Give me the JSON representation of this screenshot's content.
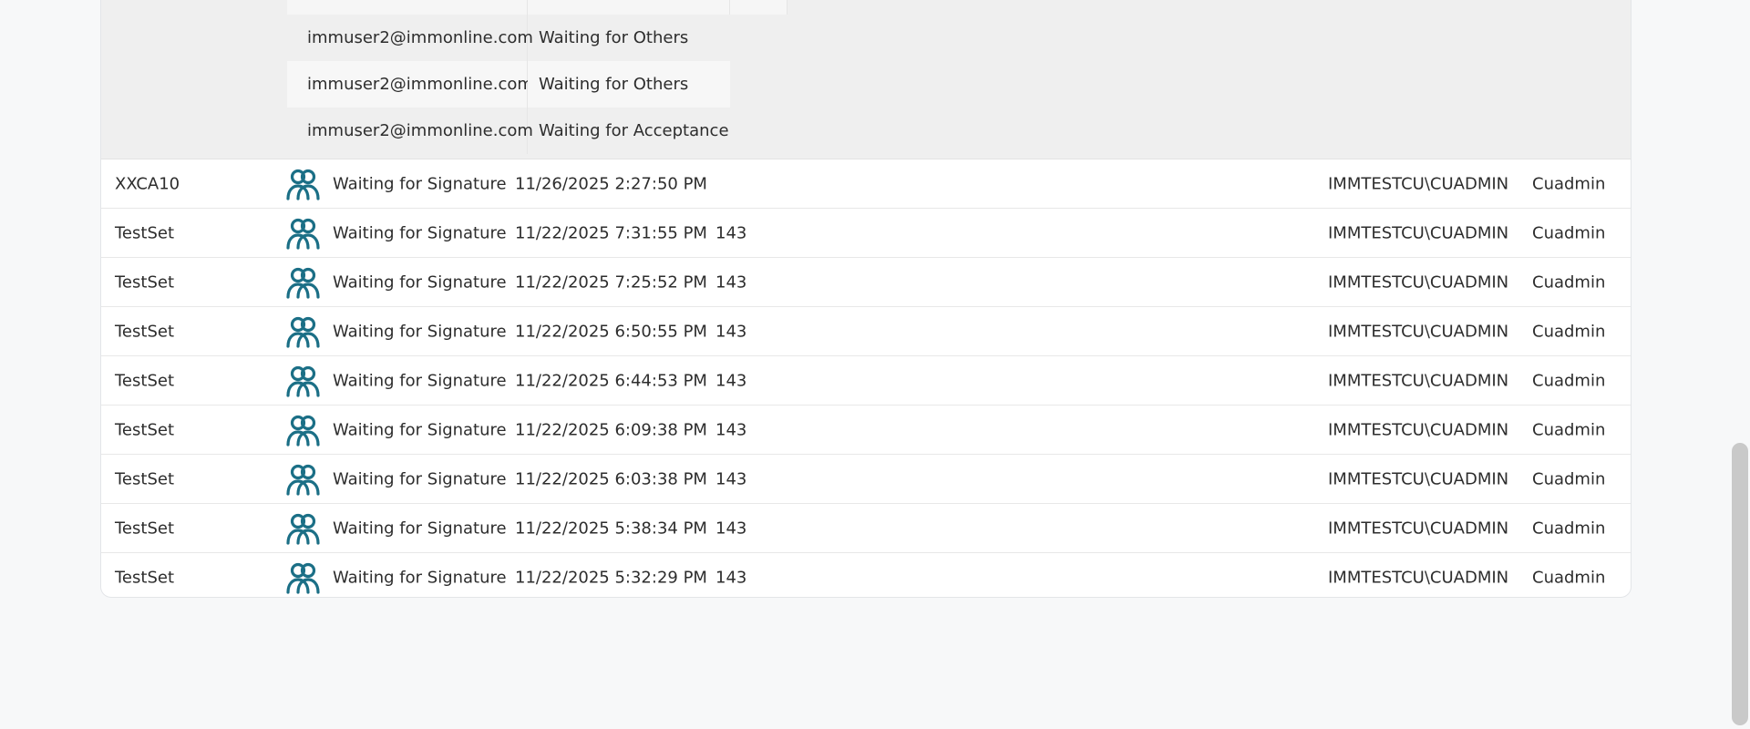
{
  "expanded_detail": {
    "rows": [
      {
        "email": "immuser2@immonline.com",
        "status": "Waiting for Others"
      },
      {
        "email": "immuser2@immonline.com",
        "status": "Waiting for Others"
      },
      {
        "email": "immuser2@immonline.com",
        "status": "Waiting for Acceptance"
      }
    ]
  },
  "rows": [
    {
      "name": "XXCA10",
      "icon": "users-icon",
      "status": "Waiting for Signature",
      "date": "11/26/2025 2:27:50 PM",
      "count": "",
      "owner": "IMMTESTCU\\CUADMIN",
      "user": "Cuadmin"
    },
    {
      "name": "TestSet",
      "icon": "users-icon",
      "status": "Waiting for Signature",
      "date": "11/22/2025 7:31:55 PM",
      "count": "143",
      "owner": "IMMTESTCU\\CUADMIN",
      "user": "Cuadmin"
    },
    {
      "name": "TestSet",
      "icon": "users-icon",
      "status": "Waiting for Signature",
      "date": "11/22/2025 7:25:52 PM",
      "count": "143",
      "owner": "IMMTESTCU\\CUADMIN",
      "user": "Cuadmin"
    },
    {
      "name": "TestSet",
      "icon": "users-icon",
      "status": "Waiting for Signature",
      "date": "11/22/2025 6:50:55 PM",
      "count": "143",
      "owner": "IMMTESTCU\\CUADMIN",
      "user": "Cuadmin"
    },
    {
      "name": "TestSet",
      "icon": "users-icon",
      "status": "Waiting for Signature",
      "date": "11/22/2025 6:44:53 PM",
      "count": "143",
      "owner": "IMMTESTCU\\CUADMIN",
      "user": "Cuadmin"
    },
    {
      "name": "TestSet",
      "icon": "users-icon",
      "status": "Waiting for Signature",
      "date": "11/22/2025 6:09:38 PM",
      "count": "143",
      "owner": "IMMTESTCU\\CUADMIN",
      "user": "Cuadmin"
    },
    {
      "name": "TestSet",
      "icon": "users-icon",
      "status": "Waiting for Signature",
      "date": "11/22/2025 6:03:38 PM",
      "count": "143",
      "owner": "IMMTESTCU\\CUADMIN",
      "user": "Cuadmin"
    },
    {
      "name": "TestSet",
      "icon": "users-icon",
      "status": "Waiting for Signature",
      "date": "11/22/2025 5:38:34 PM",
      "count": "143",
      "owner": "IMMTESTCU\\CUADMIN",
      "user": "Cuadmin"
    },
    {
      "name": "TestSet",
      "icon": "users-icon",
      "status": "Waiting for Signature",
      "date": "11/22/2025 5:32:29 PM",
      "count": "143",
      "owner": "IMMTESTCU\\CUADMIN",
      "user": "Cuadmin"
    }
  ],
  "colors": {
    "icon": "#1b6f86",
    "page_background": "#f7f8f9",
    "expanded_background": "#efefef"
  }
}
